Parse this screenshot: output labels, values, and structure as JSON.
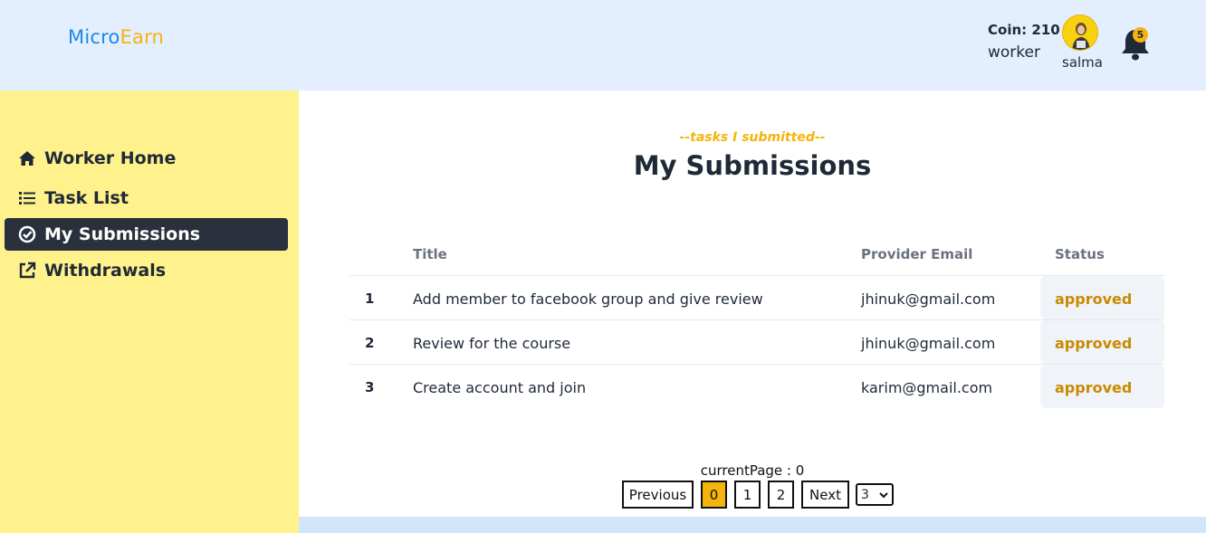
{
  "header": {
    "logo_part1": "Micro",
    "logo_part2": "Earn",
    "coin_text": "Coin: 210",
    "role": "worker",
    "username": "salma",
    "notification_count": "5"
  },
  "sidebar": {
    "items": [
      {
        "label": "Worker Home",
        "icon": "home-icon",
        "active": false
      },
      {
        "label": "Task List",
        "icon": "list-icon",
        "active": false
      },
      {
        "label": "My Submissions",
        "icon": "check-circle-icon",
        "active": true
      },
      {
        "label": "Withdrawals",
        "icon": "external-link-icon",
        "active": false
      }
    ]
  },
  "main": {
    "subtitle": "--tasks I submitted--",
    "title": "My Submissions",
    "table": {
      "headers": [
        "",
        "Title",
        "Provider Email",
        "Status"
      ],
      "rows": [
        {
          "num": "1",
          "title": "Add member to facebook group and give review",
          "email": "jhinuk@gmail.com",
          "status": "approved"
        },
        {
          "num": "2",
          "title": "Review for the course",
          "email": "jhinuk@gmail.com",
          "status": "approved"
        },
        {
          "num": "3",
          "title": "Create account and join",
          "email": "karim@gmail.com",
          "status": "approved"
        }
      ]
    },
    "pagination": {
      "current_page_text": "currentPage : 0",
      "previous_label": "Previous",
      "next_label": "Next",
      "pages": [
        "0",
        "1",
        "2"
      ],
      "active_page": "0",
      "per_page": "3"
    }
  },
  "colors": {
    "header_bg": "#e3efff",
    "sidebar_bg": "#fff18b",
    "accent": "#f5b40a",
    "logo_blue": "#1e88e5",
    "active_nav_bg": "#2a303c",
    "status_text": "#c98a00"
  }
}
